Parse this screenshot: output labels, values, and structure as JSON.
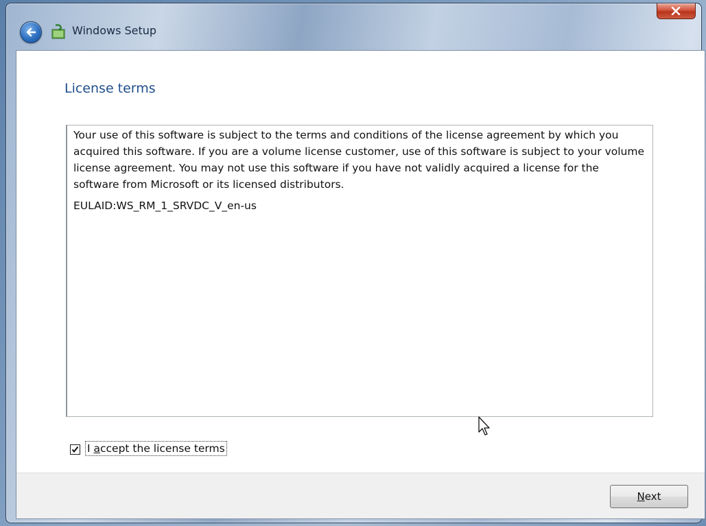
{
  "window": {
    "title": "Windows Setup",
    "back_icon": "back-arrow-icon",
    "app_icon": "windows-setup-icon",
    "close_icon": "close-icon"
  },
  "page": {
    "title": "License terms"
  },
  "license": {
    "paragraph": "Your use of this software is subject to the terms and conditions of the license agreement by which you acquired this software.  If you are a volume license customer, use of this software is subject to your volume license agreement.  You may not use this software if you have not validly acquired a license for the software from Microsoft or its licensed distributors.",
    "eula_id": "EULAID:WS_RM_1_SRVDC_V_en-us"
  },
  "accept": {
    "checked": true,
    "label_prefix": "I ",
    "label_underlined": "a",
    "label_rest": "ccept the license terms"
  },
  "footer": {
    "next_underlined": "N",
    "next_rest": "ext"
  },
  "colors": {
    "title_blue": "#1f4e8c",
    "close_red": "#c4432a",
    "footer_bg": "#f0f0f0"
  }
}
